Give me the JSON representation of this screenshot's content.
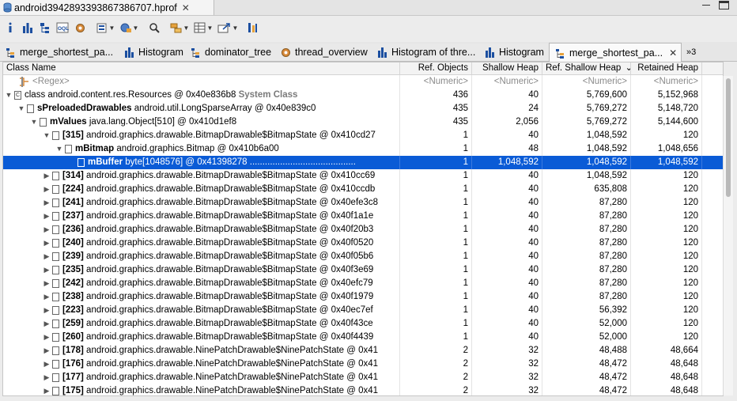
{
  "editor": {
    "title": "android3942893393867386707.hprof",
    "close_glyph": "✕"
  },
  "toolbar": {
    "items": [
      "info-icon",
      "histogram-icon",
      "dominator-tree-icon",
      "oql-icon",
      "thread-overview-icon",
      "run-report-icon",
      "query-browser-icon",
      "search-icon",
      "group-by-icon",
      "calculate-retained-icon",
      "export-icon",
      "pin-icon"
    ]
  },
  "view_tabs": [
    {
      "label": "merge_shortest_pa...",
      "icon": "tree-icon"
    },
    {
      "label": "Histogram",
      "icon": "histogram-icon"
    },
    {
      "label": "dominator_tree",
      "icon": "tree-icon"
    },
    {
      "label": "thread_overview",
      "icon": "gear-icon"
    },
    {
      "label": "Histogram of thre...",
      "icon": "histogram-icon"
    },
    {
      "label": "Histogram",
      "icon": "histogram-icon"
    },
    {
      "label": "merge_shortest_pa...",
      "icon": "tree-icon",
      "active": true,
      "close": "✕"
    },
    {
      "label": "»3",
      "icon": ""
    }
  ],
  "columns": {
    "class_name": "Class Name",
    "ref_objects": "Ref. Objects",
    "shallow_heap": "Shallow Heap",
    "ref_shallow_heap": "Ref. Shallow Heap",
    "ref_shallow_sort": "⌄",
    "retained_heap": "Retained Heap"
  },
  "filter_row": {
    "name": "<Regex>",
    "ref": "<Numeric>",
    "shallow": "<Numeric>",
    "refshallow": "<Numeric>",
    "retained": "<Numeric>"
  },
  "rows": [
    {
      "depth": 0,
      "tw": "▼",
      "ic": "C",
      "bold": "",
      "rest": "class android.content.res.Resources @ 0x40e836b8",
      "extra": "System Class",
      "ref": "436",
      "shallow": "40",
      "refshallow": "5,769,600",
      "retained": "5,152,968"
    },
    {
      "depth": 1,
      "tw": "▼",
      "ic": "",
      "bold": "sPreloadedDrawables",
      "rest": " android.util.LongSparseArray @ 0x40e839c0",
      "extra": "",
      "ref": "435",
      "shallow": "24",
      "refshallow": "5,769,272",
      "retained": "5,148,720"
    },
    {
      "depth": 2,
      "tw": "▼",
      "ic": "",
      "bold": "mValues",
      "rest": " java.lang.Object[510] @ 0x410d1ef8",
      "extra": "",
      "ref": "435",
      "shallow": "2,056",
      "refshallow": "5,769,272",
      "retained": "5,144,600"
    },
    {
      "depth": 3,
      "tw": "▼",
      "ic": "",
      "bold": "[315]",
      "rest": " android.graphics.drawable.BitmapDrawable$BitmapState @ 0x410cd27",
      "extra": "",
      "ref": "1",
      "shallow": "40",
      "refshallow": "1,048,592",
      "retained": "120"
    },
    {
      "depth": 4,
      "tw": "▼",
      "ic": "",
      "bold": "mBitmap",
      "rest": " android.graphics.Bitmap @ 0x410b6a00",
      "extra": "",
      "ref": "1",
      "shallow": "48",
      "refshallow": "1,048,592",
      "retained": "1,048,656"
    },
    {
      "depth": 5,
      "tw": "",
      "ic": "",
      "bold": "mBuffer",
      "rest": " byte[1048576] @ 0x41398278  ..........................................",
      "extra": "",
      "ref": "1",
      "shallow": "1,048,592",
      "refshallow": "1,048,592",
      "retained": "1,048,592",
      "selected": true
    },
    {
      "depth": 3,
      "tw": "▶",
      "ic": "",
      "bold": "[314]",
      "rest": " android.graphics.drawable.BitmapDrawable$BitmapState @ 0x410cc69",
      "extra": "",
      "ref": "1",
      "shallow": "40",
      "refshallow": "1,048,592",
      "retained": "120"
    },
    {
      "depth": 3,
      "tw": "▶",
      "ic": "",
      "bold": "[224]",
      "rest": " android.graphics.drawable.BitmapDrawable$BitmapState @ 0x410ccdb",
      "extra": "",
      "ref": "1",
      "shallow": "40",
      "refshallow": "635,808",
      "retained": "120"
    },
    {
      "depth": 3,
      "tw": "▶",
      "ic": "",
      "bold": "[241]",
      "rest": " android.graphics.drawable.BitmapDrawable$BitmapState @ 0x40efe3c8",
      "extra": "",
      "ref": "1",
      "shallow": "40",
      "refshallow": "87,280",
      "retained": "120"
    },
    {
      "depth": 3,
      "tw": "▶",
      "ic": "",
      "bold": "[237]",
      "rest": " android.graphics.drawable.BitmapDrawable$BitmapState @ 0x40f1a1e",
      "extra": "",
      "ref": "1",
      "shallow": "40",
      "refshallow": "87,280",
      "retained": "120"
    },
    {
      "depth": 3,
      "tw": "▶",
      "ic": "",
      "bold": "[236]",
      "rest": " android.graphics.drawable.BitmapDrawable$BitmapState @ 0x40f20b3",
      "extra": "",
      "ref": "1",
      "shallow": "40",
      "refshallow": "87,280",
      "retained": "120"
    },
    {
      "depth": 3,
      "tw": "▶",
      "ic": "",
      "bold": "[240]",
      "rest": " android.graphics.drawable.BitmapDrawable$BitmapState @ 0x40f0520",
      "extra": "",
      "ref": "1",
      "shallow": "40",
      "refshallow": "87,280",
      "retained": "120"
    },
    {
      "depth": 3,
      "tw": "▶",
      "ic": "",
      "bold": "[239]",
      "rest": " android.graphics.drawable.BitmapDrawable$BitmapState @ 0x40f05b6",
      "extra": "",
      "ref": "1",
      "shallow": "40",
      "refshallow": "87,280",
      "retained": "120"
    },
    {
      "depth": 3,
      "tw": "▶",
      "ic": "",
      "bold": "[235]",
      "rest": " android.graphics.drawable.BitmapDrawable$BitmapState @ 0x40f3e69",
      "extra": "",
      "ref": "1",
      "shallow": "40",
      "refshallow": "87,280",
      "retained": "120"
    },
    {
      "depth": 3,
      "tw": "▶",
      "ic": "",
      "bold": "[242]",
      "rest": " android.graphics.drawable.BitmapDrawable$BitmapState @ 0x40efc79",
      "extra": "",
      "ref": "1",
      "shallow": "40",
      "refshallow": "87,280",
      "retained": "120"
    },
    {
      "depth": 3,
      "tw": "▶",
      "ic": "",
      "bold": "[238]",
      "rest": " android.graphics.drawable.BitmapDrawable$BitmapState @ 0x40f1979",
      "extra": "",
      "ref": "1",
      "shallow": "40",
      "refshallow": "87,280",
      "retained": "120"
    },
    {
      "depth": 3,
      "tw": "▶",
      "ic": "",
      "bold": "[223]",
      "rest": " android.graphics.drawable.BitmapDrawable$BitmapState @ 0x40ec7ef",
      "extra": "",
      "ref": "1",
      "shallow": "40",
      "refshallow": "56,392",
      "retained": "120"
    },
    {
      "depth": 3,
      "tw": "▶",
      "ic": "",
      "bold": "[259]",
      "rest": " android.graphics.drawable.BitmapDrawable$BitmapState @ 0x40f43ce",
      "extra": "",
      "ref": "1",
      "shallow": "40",
      "refshallow": "52,000",
      "retained": "120"
    },
    {
      "depth": 3,
      "tw": "▶",
      "ic": "",
      "bold": "[260]",
      "rest": " android.graphics.drawable.BitmapDrawable$BitmapState @ 0x40f4439",
      "extra": "",
      "ref": "1",
      "shallow": "40",
      "refshallow": "52,000",
      "retained": "120"
    },
    {
      "depth": 3,
      "tw": "▶",
      "ic": "",
      "bold": "[178]",
      "rest": " android.graphics.drawable.NinePatchDrawable$NinePatchState @ 0x41",
      "extra": "",
      "ref": "2",
      "shallow": "32",
      "refshallow": "48,488",
      "retained": "48,664"
    },
    {
      "depth": 3,
      "tw": "▶",
      "ic": "",
      "bold": "[176]",
      "rest": " android.graphics.drawable.NinePatchDrawable$NinePatchState @ 0x41",
      "extra": "",
      "ref": "2",
      "shallow": "32",
      "refshallow": "48,472",
      "retained": "48,648"
    },
    {
      "depth": 3,
      "tw": "▶",
      "ic": "",
      "bold": "[177]",
      "rest": " android.graphics.drawable.NinePatchDrawable$NinePatchState @ 0x41",
      "extra": "",
      "ref": "2",
      "shallow": "32",
      "refshallow": "48,472",
      "retained": "48,648"
    },
    {
      "depth": 3,
      "tw": "▶",
      "ic": "",
      "bold": "[175]",
      "rest": " android.graphics.drawable.NinePatchDrawable$NinePatchState @ 0x41",
      "extra": "",
      "ref": "2",
      "shallow": "32",
      "refshallow": "48,472",
      "retained": "48,648"
    }
  ]
}
